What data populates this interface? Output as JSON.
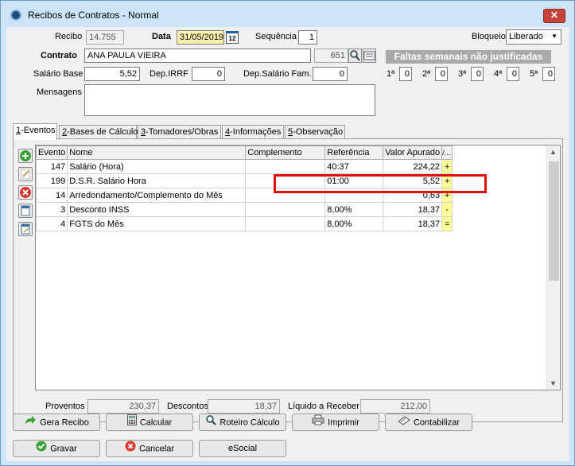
{
  "window": {
    "title": "Recibos de Contratos - Normal",
    "close_label": "✕"
  },
  "header": {
    "recibo_label": "Recibo",
    "recibo_value": "14.755",
    "data_label": "Data",
    "data_value": "31/05/2019",
    "cal_label": "12",
    "sequencia_label": "Sequência",
    "sequencia_value": "1",
    "bloqueio_label": "Bloqueio",
    "bloqueio_value": "Liberado",
    "contrato_label": "Contrato",
    "contrato_name": "ANA PAULA VIEIRA",
    "contrato_code": "651",
    "salario_label": "Salário Base",
    "salario_value": "5,52",
    "irrf_label": "Dep.IRRF",
    "irrf_value": "0",
    "salfam_label": "Dep.Salário Fam.",
    "salfam_value": "0",
    "mensagens_label": "Mensagens",
    "mensagens_value": ""
  },
  "faltas": {
    "title": "Faltas semanais não justificadas",
    "weeks": [
      {
        "label": "1ª",
        "value": "0"
      },
      {
        "label": "2ª",
        "value": "0"
      },
      {
        "label": "3ª",
        "value": "0"
      },
      {
        "label": "4ª",
        "value": "0"
      },
      {
        "label": "5ª",
        "value": "0"
      }
    ]
  },
  "tabs": [
    {
      "key": "1",
      "label": "-Eventos"
    },
    {
      "key": "2",
      "label": "-Bases de Cálculo"
    },
    {
      "key": "3",
      "label": "-Tomadores/Obras"
    },
    {
      "key": "4",
      "label": "-Informações"
    },
    {
      "key": "5",
      "label": "-Observação"
    }
  ],
  "grid": {
    "columns": [
      "Evento",
      "Nome",
      "Complemento",
      "Referência",
      "Valor Apurado",
      "/..."
    ],
    "rows": [
      {
        "evento": "147",
        "nome": "Salário (Hora)",
        "complemento": "",
        "referencia": "40:37",
        "valor": "224,22",
        "sinal": "+"
      },
      {
        "evento": "199",
        "nome": "D.S.R. Salário Hora",
        "complemento": "",
        "referencia": "01:00",
        "valor": "5,52",
        "sinal": "+"
      },
      {
        "evento": "14",
        "nome": "Arredondamento/Complemento do Mês",
        "complemento": "",
        "referencia": "",
        "valor": "0,63",
        "sinal": "+"
      },
      {
        "evento": "3",
        "nome": "Desconto INSS",
        "complemento": "",
        "referencia": "8,00%",
        "valor": "18,37",
        "sinal": "-"
      },
      {
        "evento": "4",
        "nome": "FGTS do Mês",
        "complemento": "",
        "referencia": "8,00%",
        "valor": "18,37",
        "sinal": "="
      }
    ]
  },
  "totals": {
    "proventos_label": "Proventos",
    "proventos_value": "230,37",
    "descontos_label": "Descontos",
    "descontos_value": "18,37",
    "liquido_label": "Líquido a Receber",
    "liquido_value": "212,00"
  },
  "buttons": {
    "gera_recibo": "Gera Recibo",
    "calcular": "Calcular",
    "roteiro": "Roteiro Cálculo",
    "imprimir": "Imprimir",
    "contabilizar": "Contabilizar",
    "gravar": "Gravar",
    "cancelar": "Cancelar",
    "esocial": "eSocial"
  },
  "colors": {
    "title_bg": "#cce4f7",
    "highlight": "#e01010",
    "faltas_bg": "#a9a9a9",
    "date_bg": "#fff3b0",
    "sign_bg": "#ffff99"
  }
}
